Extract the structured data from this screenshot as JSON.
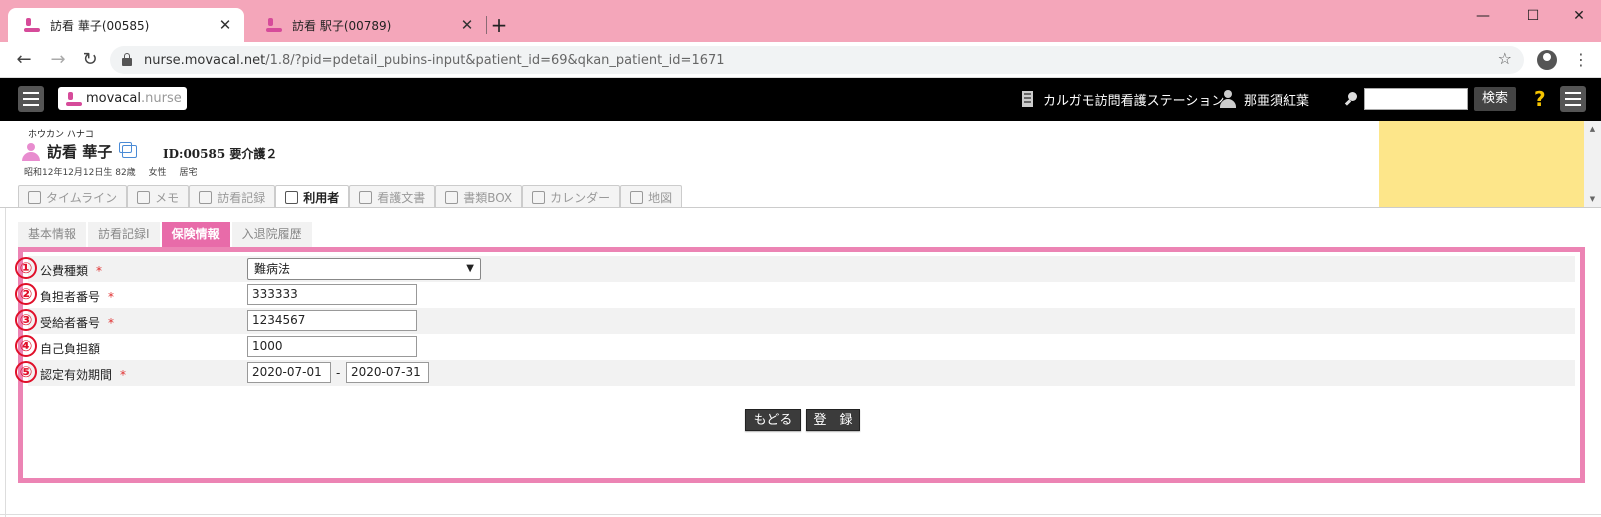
{
  "browser": {
    "tabs": [
      {
        "title": "訪看 華子(00585)",
        "active": true
      },
      {
        "title": "訪看 駅子(00789)",
        "active": false
      }
    ],
    "new_tab": "+",
    "window_controls": {
      "minimize": "—",
      "maximize": "☐",
      "close": "✕"
    },
    "url_host": "nurse.movacal.net",
    "url_path": "/1.8/?pid=pdetail_pubins-input&patient_id=69&qkan_patient_id=1671"
  },
  "header": {
    "logo_bold": "movacal",
    "logo_light": ".nurse",
    "station": "カルガモ訪問看護ステーション",
    "user": "那亜須紅葉",
    "search_button": "検索",
    "help": "?"
  },
  "patient": {
    "kana": "ホウカン ハナコ",
    "name": "訪看 華子",
    "id_care": "ID:00585 要介護２",
    "birth": "昭和12年12月12日生 82歳",
    "sex": "女性",
    "residence": "居宅"
  },
  "main_tabs": [
    {
      "label": "タイムライン",
      "icon": "timeline-icon"
    },
    {
      "label": "メモ",
      "icon": "pencil-icon"
    },
    {
      "label": "訪看記録",
      "icon": "record-icon"
    },
    {
      "label": "利用者",
      "icon": "id-card-icon"
    },
    {
      "label": "看護文書",
      "icon": "pdf-icon"
    },
    {
      "label": "書類BOX",
      "icon": "box-icon"
    },
    {
      "label": "カレンダー",
      "icon": "calendar-icon"
    },
    {
      "label": "地図",
      "icon": "map-icon"
    }
  ],
  "sub_tabs": [
    "基本情報",
    "訪看記録Ⅰ",
    "保険情報",
    "入退院履歴"
  ],
  "form": {
    "rows": [
      {
        "num": "①",
        "label": "公費種類",
        "required": true
      },
      {
        "num": "②",
        "label": "負担者番号",
        "required": true
      },
      {
        "num": "③",
        "label": "受給者番号",
        "required": true
      },
      {
        "num": "④",
        "label": "自己負担額",
        "required": false
      },
      {
        "num": "⑤",
        "label": "認定有効期間",
        "required": true
      }
    ],
    "required_mark": "*",
    "public_type": "難病法",
    "payer_number": "333333",
    "recipient_number": "1234567",
    "copay": "1000",
    "valid_from": "2020-07-01",
    "date_separator": "-",
    "valid_to": "2020-07-31",
    "back_button": "もどる",
    "register_button": "登　録"
  },
  "colors": {
    "tab_strip": "#f4a6ba",
    "accent_pink": "#e86ba9",
    "form_border": "#ec84b4",
    "marker_red": "#e0102a",
    "notice_yellow": "#fde68a"
  }
}
